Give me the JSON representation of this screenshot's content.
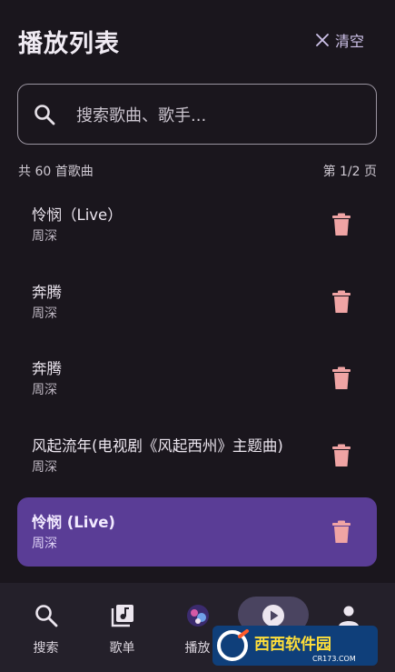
{
  "header": {
    "title": "播放列表",
    "clear_label": "清空"
  },
  "search": {
    "placeholder": "搜索歌曲、歌手..."
  },
  "meta": {
    "count": "共 60 首歌曲",
    "page": "第 1/2 页"
  },
  "songs": [
    {
      "title": "怜悯（Live）",
      "artist": "周深",
      "active": false
    },
    {
      "title": "奔腾",
      "artist": "周深",
      "active": false
    },
    {
      "title": "奔腾",
      "artist": "周深",
      "active": false
    },
    {
      "title": "风起流年(电视剧《风起西州》主题曲)",
      "artist": "周深",
      "active": false
    },
    {
      "title": "怜悯 (Live)",
      "artist": "周深",
      "active": true
    }
  ],
  "nav": {
    "items": [
      {
        "label": "搜索",
        "icon": "search-icon"
      },
      {
        "label": "歌单",
        "icon": "music-library-icon"
      },
      {
        "label": "播放",
        "icon": "album-art-icon"
      },
      {
        "label": "",
        "icon": "play-circle-icon",
        "selected": true
      },
      {
        "label": "",
        "icon": "person-icon"
      }
    ]
  },
  "watermark": {
    "text": "西西软件园",
    "sub": "CR173.COM"
  },
  "colors": {
    "background": "#1a161d",
    "accent": "#5a3d96",
    "delete": "#f0a4a4",
    "nav": "#24202a"
  }
}
